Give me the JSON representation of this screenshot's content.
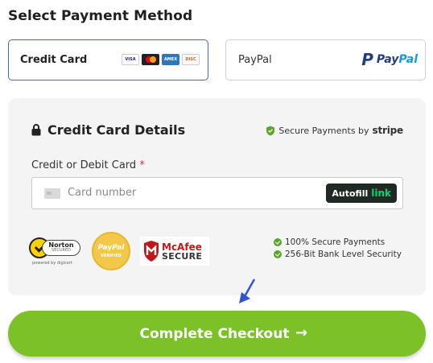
{
  "section_title": "Select Payment Method",
  "methods": {
    "credit_card": {
      "label": "Credit Card",
      "card_brands": [
        "VISA",
        "Mastercard",
        "AMEX",
        "DISCOVER"
      ]
    },
    "paypal": {
      "label": "PayPal",
      "logo_text_pay": "Pay",
      "logo_text_pal": "Pal"
    }
  },
  "panel": {
    "title": "Credit Card Details",
    "secure_text": "Secure Payments by",
    "secure_brand": "stripe",
    "field_label": "Credit or Debit Card",
    "required_mark": "*",
    "card_placeholder": "Card number",
    "autofill_text": "Autofill",
    "autofill_link": "link"
  },
  "badges": {
    "norton_name": "Norton",
    "norton_secured": "SECURED",
    "norton_by": "powered by digicert",
    "paypal_seal_1": "PayPal",
    "paypal_seal_2": "VERIFIED",
    "mcafee_1": "McAfee",
    "mcafee_2": "SECURE"
  },
  "checks": [
    "100% Secure Payments",
    "256-Bit Bank Level Security"
  ],
  "checkout": {
    "label": "Complete Checkout",
    "arrow": "→"
  },
  "colors": {
    "accent_green": "#7cc127",
    "selected_border": "#3f6fa0",
    "check_green": "#5aa629",
    "arrow_blue": "#2f55d4"
  }
}
